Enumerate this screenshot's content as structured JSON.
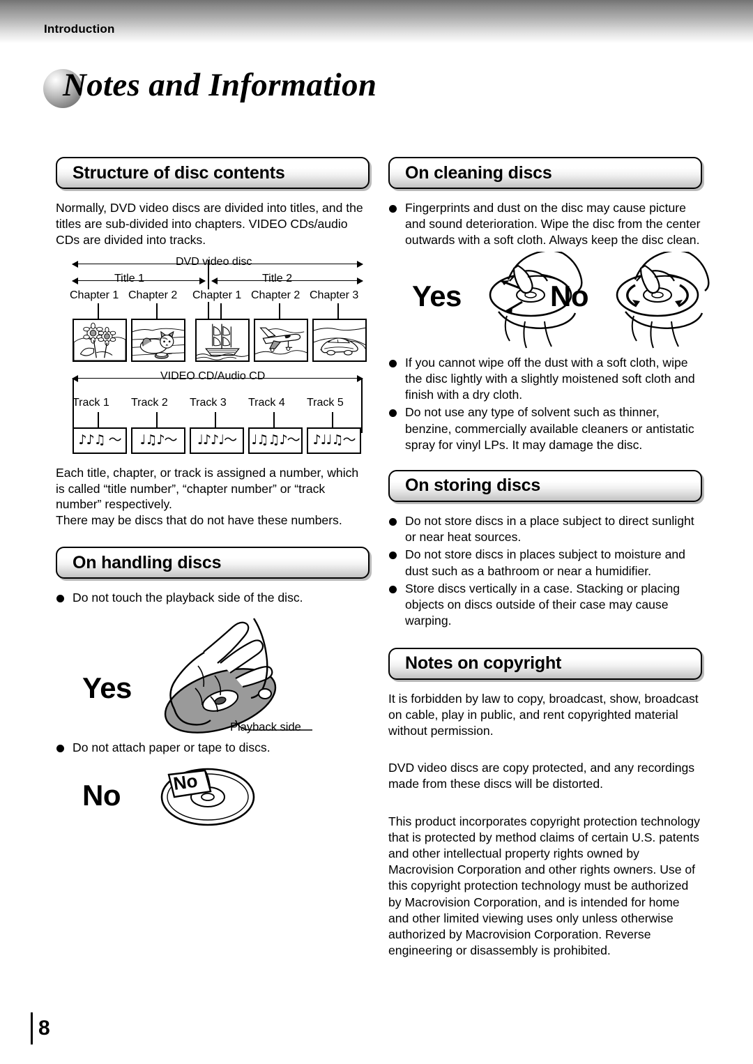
{
  "header": {
    "running_head": "Introduction"
  },
  "title": {
    "text": "Notes and Information"
  },
  "left_column": {
    "structure": {
      "heading": "Structure of disc contents",
      "intro": "Normally, DVD video discs are divided into titles, and the titles are sub-divided into chapters. VIDEO CDs/audio CDs are divided into tracks.",
      "dvd_diagram": {
        "span_label": "DVD video disc",
        "title_labels": [
          "Title 1",
          "Title 2"
        ],
        "chapter_labels": [
          "Chapter 1",
          "Chapter 2",
          "Chapter 1",
          "Chapter 2",
          "Chapter 3"
        ],
        "thumbnails": [
          "sunflowers-illustration",
          "cat-illustration",
          "sailing-ship-illustration",
          "airplane-illustration",
          "car-illustration"
        ]
      },
      "cd_diagram": {
        "span_label": "VIDEO CD/Audio CD",
        "track_labels": [
          "Track 1",
          "Track 2",
          "Track 3",
          "Track 4",
          "Track 5"
        ],
        "track_glyphs": [
          "♪♪♫ ～",
          "♩♫♪～",
          "♩♪♪♩～",
          "♩♫♫♪～",
          "♪♩♩♫～"
        ]
      },
      "outro_1": "Each title, chapter, or track is assigned a number, which is called “title number”, “chapter number” or “track number” respectively.",
      "outro_2": "There may be discs that do not have these numbers."
    },
    "handling": {
      "heading": "On handling discs",
      "bullets": [
        "Do not touch the playback side of the disc.",
        "Do not attach paper or tape to discs."
      ],
      "yes_word": "Yes",
      "no_word": "No",
      "sticker_word": "No",
      "callout": "Playback side"
    }
  },
  "right_column": {
    "cleaning": {
      "heading": "On cleaning discs",
      "bullet_1": "Fingerprints and dust on the disc may cause picture and sound deterioration. Wipe the disc from the center outwards with a soft cloth. Always keep the disc clean.",
      "yes_word": "Yes",
      "no_word": "No",
      "bullets": [
        "If you cannot wipe off the dust with a soft cloth, wipe the disc lightly with a slightly moistened soft cloth and finish with a dry cloth.",
        "Do not use any type of solvent such as thinner, benzine, commercially available cleaners or antistatic spray for vinyl LPs. It may damage the disc."
      ]
    },
    "storing": {
      "heading": "On storing discs",
      "bullets": [
        "Do not store discs in a place subject to direct sunlight or near heat sources.",
        "Do not store discs in places subject to moisture and dust such as a bathroom or near a humidifier.",
        "Store discs vertically in a case. Stacking or placing objects on discs outside of their case may cause warping."
      ]
    },
    "copyright": {
      "heading": "Notes on copyright",
      "paragraph_1": "It is forbidden by law to copy, broadcast, show, broadcast on cable, play in public, and rent copyrighted material without permission.",
      "paragraph_2": "DVD video discs are copy protected, and any recordings made from these discs will be distorted.",
      "paragraph_3": "This product incorporates copyright protection technology that is protected by method claims of certain U.S. patents and other intellectual property rights owned by Macrovision Corporation and other rights owners. Use of this copyright protection technology must be authorized by Macrovision Corporation, and is intended for home and other limited viewing uses only unless otherwise authorized by Macrovision Corporation. Reverse engineering or disassembly is prohibited."
    }
  },
  "footer": {
    "page_number": "8"
  }
}
